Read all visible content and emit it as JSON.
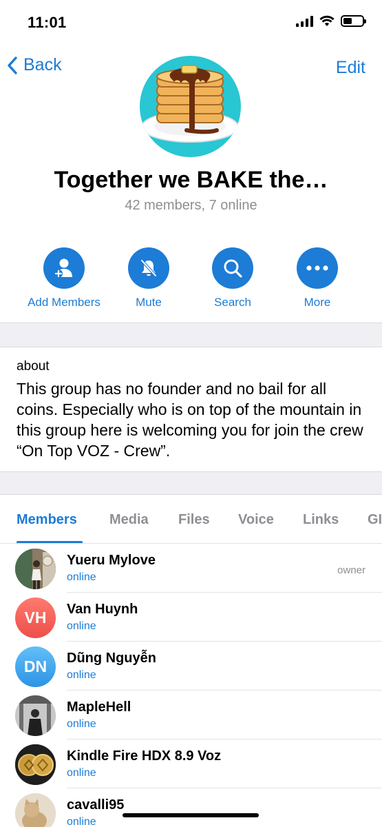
{
  "status_bar": {
    "time": "11:01"
  },
  "nav": {
    "back_label": "Back",
    "edit_label": "Edit"
  },
  "group": {
    "title": "Together we BAKE the…",
    "subtitle": "42 members, 7 online"
  },
  "actions": [
    {
      "label": "Add Members",
      "icon": "add-member-icon"
    },
    {
      "label": "Mute",
      "icon": "bell-slash-icon"
    },
    {
      "label": "Search",
      "icon": "search-icon"
    },
    {
      "label": "More",
      "icon": "more-icon"
    }
  ],
  "about": {
    "label": "about",
    "text": "This group has no founder and no bail for all coins. Especially who is on top of the mountain in this group here is welcoming you for join the crew “On Top VOZ - Crew”."
  },
  "tabs": [
    {
      "label": "Members",
      "active": true
    },
    {
      "label": "Media"
    },
    {
      "label": "Files"
    },
    {
      "label": "Voice"
    },
    {
      "label": "Links"
    },
    {
      "label": "GI"
    }
  ],
  "members": [
    {
      "name": "Yueru Mylove",
      "status": "online",
      "role": "owner",
      "avatar": "photo"
    },
    {
      "name": "Van Huynh",
      "status": "online",
      "avatar_initials": "VH"
    },
    {
      "name": "Dũng Nguyễn",
      "status": "online",
      "avatar_initials": "DN"
    },
    {
      "name": "MapleHell",
      "status": "online",
      "avatar": "photo"
    },
    {
      "name": "Kindle Fire HDX 8.9 Voz",
      "status": "online",
      "avatar": "photo"
    },
    {
      "name": "cavalli95",
      "status": "online",
      "avatar": "photo"
    }
  ],
  "colors": {
    "accent": "#1c7cd6",
    "secondary_text": "#8e8e93",
    "section_gap": "#efeff4",
    "group_avatar_bg": "#29c6d3",
    "avatar_vh": "#f2605a",
    "avatar_dn": "#3fa6f0"
  }
}
